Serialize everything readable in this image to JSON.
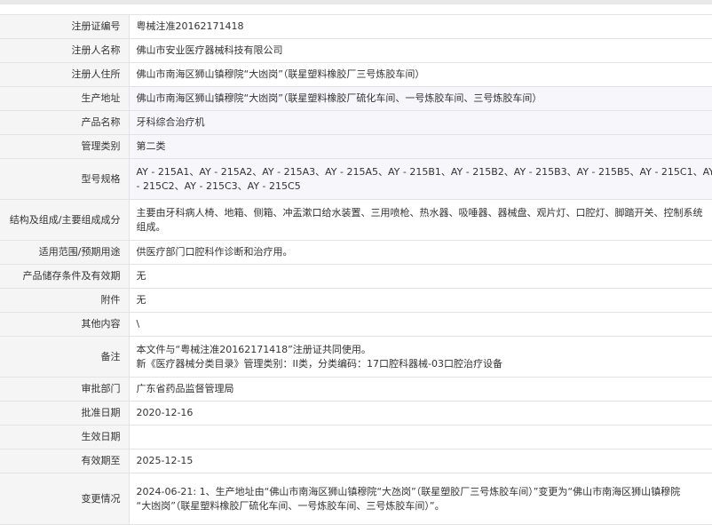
{
  "rows": [
    {
      "label": "注册证编号",
      "lines": [
        "粤械注准20162171418"
      ]
    },
    {
      "label": "注册人名称",
      "lines": [
        "佛山市安业医疗器械科技有限公司"
      ]
    },
    {
      "label": "注册人住所",
      "lines": [
        "佛山市南海区狮山镇穆院“大凼岗”（联星塑料橡胶厂三号炼胶车间）"
      ]
    },
    {
      "label": "生产地址",
      "lines": [
        "佛山市南海区狮山镇穆院“大凼岗”（联星塑料橡胶厂硫化车间、一号炼胶车间、三号炼胶车间）"
      ]
    },
    {
      "label": "产品名称",
      "lines": [
        "牙科综合治疗机"
      ]
    },
    {
      "label": "管理类别",
      "lines": [
        "第二类"
      ]
    },
    {
      "label": "型号规格",
      "lines": [
        "AY - 215A1、AY - 215A2、AY - 215A3、AY - 215A5、AY - 215B1、AY - 215B2、AY - 215B3、AY - 215B5、AY - 215C1、AY",
        "- 215C2、AY - 215C3、AY - 215C5"
      ]
    },
    {
      "label": "结构及组成/主要组成成分",
      "lines": [
        "主要由牙科病人椅、地箱、侧箱、冲盂漱口给水装置、三用喷枪、热水器、吸唾器、器械盘、观片灯、口腔灯、脚踏开关、控制系统",
        "组成。"
      ]
    },
    {
      "label": "适用范围/预期用途",
      "lines": [
        "供医疗部门口腔科作诊断和治疗用。"
      ]
    },
    {
      "label": "产品储存条件及有效期",
      "lines": [
        "无"
      ]
    },
    {
      "label": "附件",
      "lines": [
        "无"
      ]
    },
    {
      "label": "其他内容",
      "lines": [
        "\\"
      ]
    },
    {
      "label": "备注",
      "lines": [
        "本文件与“粤械注准20162171418”注册证共同使用。",
        "新《医疗器械分类目录》管理类别：II类，分类编码：17口腔科器械-03口腔治疗设备"
      ]
    },
    {
      "label": "审批部门",
      "lines": [
        "广东省药品监督管理局"
      ]
    },
    {
      "label": "批准日期",
      "lines": [
        "2020-12-16"
      ]
    },
    {
      "label": "生效日期",
      "lines": [
        ""
      ]
    },
    {
      "label": "有效期至",
      "lines": [
        "2025-12-15"
      ]
    },
    {
      "label": "变更情况",
      "lines": [
        "2024-06-21: 1、生产地址由“佛山市南海区狮山镇穆院“大氹岗”（联星塑胶厂三号炼胶车间）”变更为“佛山市南海区狮山镇穆院",
        " “大凼岗”（联星塑料橡胶厂硫化车间、一号炼胶车间、三号炼胶车间）”。"
      ]
    }
  ]
}
